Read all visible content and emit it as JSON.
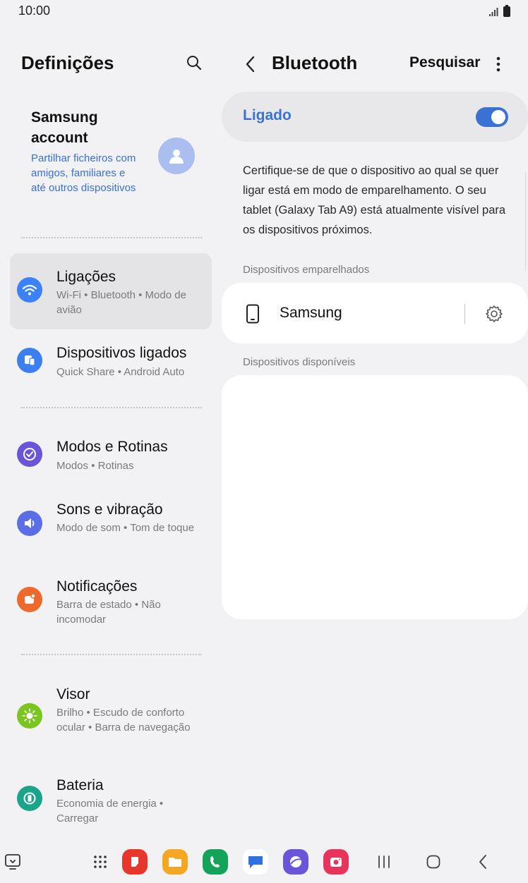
{
  "status_bar": {
    "time": "10:00"
  },
  "left_panel": {
    "title": "Definições",
    "account": {
      "title": "Samsung account",
      "subtitle": "Partilhar ficheiros com amigos, familiares e até outros dispositivos"
    },
    "items": [
      {
        "title": "Ligações",
        "subtitle": "Wi-Fi • Bluetooth • Modo de avião",
        "icon": "wifi-icon",
        "color": "#3b82f6",
        "selected": true
      },
      {
        "title": "Dispositivos ligados",
        "subtitle": "Quick Share • Android Auto",
        "icon": "devices-icon",
        "color": "#3b7ff0"
      },
      {
        "title": "Modos e Rotinas",
        "subtitle": "Modos • Rotinas",
        "icon": "check-circle-icon",
        "color": "#6a55d8"
      },
      {
        "title": "Sons e vibração",
        "subtitle": "Modo de som • Tom de toque",
        "icon": "speaker-icon",
        "color": "#5b6ee6"
      },
      {
        "title": "Notificações",
        "subtitle": "Barra de estado • Não incomodar",
        "icon": "notification-icon",
        "color": "#ee6a2c"
      },
      {
        "title": "Visor",
        "subtitle": "Brilho • Escudo de conforto ocular • Barra de navegação",
        "icon": "sun-icon",
        "color": "#7cc520"
      },
      {
        "title": "Bateria",
        "subtitle": "Economia de energia • Carregar",
        "icon": "battery-icon",
        "color": "#1aa58a"
      }
    ]
  },
  "right_panel": {
    "title": "Bluetooth",
    "search_label": "Pesquisar",
    "toggle": {
      "label": "Ligado",
      "on": true,
      "color": "#3a72d4"
    },
    "description": "Certifique-se de que o dispositivo ao qual se quer ligar está em modo de emparelhamento. O seu tablet (Galaxy Tab A9) está atualmente visível para os dispositivos próximos.",
    "paired_label": "Dispositivos emparelhados",
    "paired_devices": [
      {
        "name": "Samsung",
        "icon": "phone-icon"
      }
    ],
    "available_label": "Dispositivos disponíveis"
  },
  "dock": {
    "apps": [
      {
        "name": "samsung-notes",
        "color": "#e8362c"
      },
      {
        "name": "my-files",
        "color": "#f5a623"
      },
      {
        "name": "phone",
        "color": "#14a35a"
      },
      {
        "name": "messages",
        "color": "#2f6fe0"
      },
      {
        "name": "internet",
        "color": "#6a55d8"
      },
      {
        "name": "camera",
        "color": "#e8345a"
      }
    ]
  }
}
